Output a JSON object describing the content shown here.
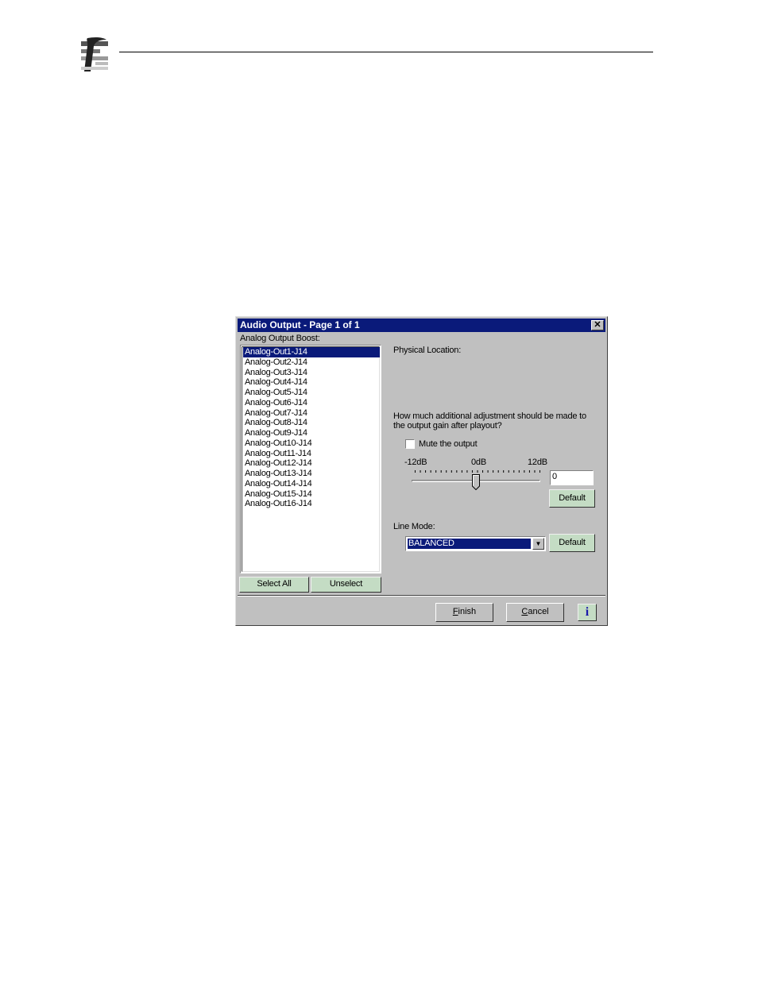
{
  "dialog": {
    "title": "Audio Output - Page 1 of 1",
    "close_glyph": "✕",
    "list_label": "Analog Output Boost:",
    "outputs": [
      "Analog-Out1-J14",
      "Analog-Out2-J14",
      "Analog-Out3-J14",
      "Analog-Out4-J14",
      "Analog-Out5-J14",
      "Analog-Out6-J14",
      "Analog-Out7-J14",
      "Analog-Out8-J14",
      "Analog-Out9-J14",
      "Analog-Out10-J14",
      "Analog-Out11-J14",
      "Analog-Out12-J14",
      "Analog-Out13-J14",
      "Analog-Out14-J14",
      "Analog-Out15-J14",
      "Analog-Out16-J14"
    ],
    "selected_output": "Analog-Out1-J14",
    "select_all_label": "Select All",
    "unselect_label": "Unselect",
    "physical_location_label": "Physical Location:",
    "question_line1": "How much additional adjustment should be made to",
    "question_line2": "the output gain after playout?",
    "mute_label": "Mute the output",
    "mute_checked": false,
    "slider": {
      "min_label": "-12dB",
      "mid_label": "0dB",
      "max_label": "12dB",
      "value": 0,
      "min": -12,
      "max": 12
    },
    "gain_value": "0",
    "default_label": "Default",
    "line_mode_label": "Line Mode:",
    "line_mode_value": "BALANCED",
    "dropdown_arrow_glyph": "▼",
    "finish_label": "Finish",
    "cancel_label": "Cancel",
    "info_label": "i"
  },
  "colors": {
    "title_bar": "#0a1a7a",
    "dialog_bg": "#c0c0c0",
    "green_button": "#c4dcc4",
    "info_glyph": "#1a1aaa"
  }
}
